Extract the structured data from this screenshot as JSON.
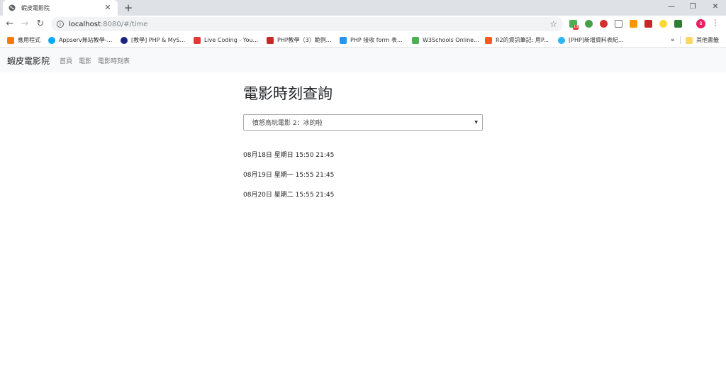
{
  "browser": {
    "tab_title": "蝦皮電影院",
    "url_host": "localhost",
    "url_path": ":8080/#/time",
    "bookmarks": [
      {
        "label": "應用程式",
        "color": "#f57c00"
      },
      {
        "label": "Appserv無站教學-...",
        "color": "#03a9f4"
      },
      {
        "label": "[教學] PHP & MyS...",
        "color": "#1a237e"
      },
      {
        "label": "Live Coding - You...",
        "color": "#e53935"
      },
      {
        "label": "PHP教學（3）範例...",
        "color": "#c62828"
      },
      {
        "label": "PHP 接收 form 表...",
        "color": "#2196f3"
      },
      {
        "label": "W3Schools Online...",
        "color": "#4caf50"
      },
      {
        "label": "R2的資訊筆記: 用P...",
        "color": "#ff5722"
      },
      {
        "label": "[PHP]新增資料表紀...",
        "color": "#29b6f6"
      }
    ],
    "other_bookmarks": "其他書籤",
    "extension_count": "10",
    "profile_letter": "B"
  },
  "nav": {
    "brand": "蝦皮電影院",
    "links": [
      "首頁",
      "電影",
      "電影時刻表"
    ]
  },
  "main": {
    "heading": "電影時刻查詢",
    "selected_movie": "憤怒鳥玩電影 2：冰的啦",
    "showtimes": [
      "08月18日 星期日 15:50 21:45",
      "08月19日 星期一 15:55 21:45",
      "08月20日 星期二 15:55 21:45"
    ]
  }
}
